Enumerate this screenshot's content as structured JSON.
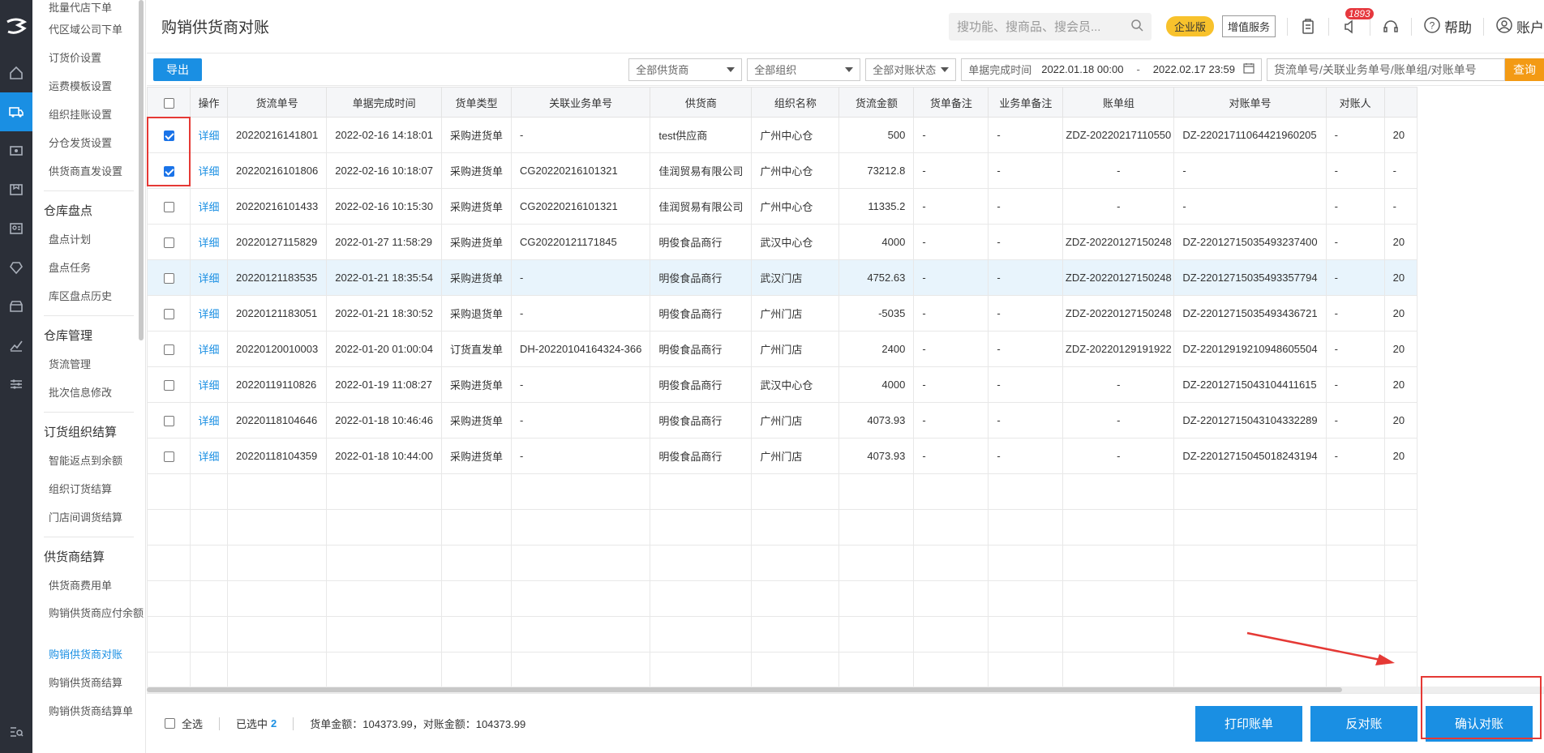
{
  "page": {
    "title": "购销供货商对账"
  },
  "submenu": {
    "items_top": [
      "批量代店下单",
      "代区域公司下单",
      "订货价设置",
      "运费模板设置",
      "组织挂账设置",
      "分仓发货设置",
      "供货商直发设置"
    ],
    "group_inventory": {
      "title": "仓库盘点",
      "items": [
        "盘点计划",
        "盘点任务",
        "库区盘点历史"
      ]
    },
    "group_warehouse": {
      "title": "仓库管理",
      "items": [
        "货流管理",
        "批次信息修改"
      ]
    },
    "group_org_settle": {
      "title": "订货组织结算",
      "items": [
        "智能返点到余额",
        "组织订货结算",
        "门店间调货结算"
      ]
    },
    "group_supplier_settle": {
      "title": "供货商结算",
      "items": [
        "供货商费用单",
        "购销供货商应付余额",
        "购销供货商对账",
        "购销供货商结算",
        "购销供货商结算单"
      ]
    }
  },
  "topbar": {
    "search_placeholder": "搜功能、搜商品、搜会员...",
    "edition_badge": "企业版",
    "value_added": "增值服务",
    "notification_count": "1893",
    "help": "帮助",
    "account": "账户"
  },
  "filters": {
    "export": "导出",
    "supplier": "全部供货商",
    "org": "全部组织",
    "status": "全部对账状态",
    "date_label": "单据完成时间",
    "date_start": "2022.01.18 00:00",
    "date_sep": "-",
    "date_end": "2022.02.17 23:59",
    "keyword_placeholder": "货流单号/关联业务单号/账单组/对账单号",
    "query": "查询"
  },
  "table": {
    "headers": [
      "操作",
      "货流单号",
      "单据完成时间",
      "货单类型",
      "关联业务单号",
      "供货商",
      "组织名称",
      "货流金额",
      "货单备注",
      "业务单备注",
      "账单组",
      "对账单号",
      "对账人",
      ""
    ],
    "detail_label": "详细",
    "rows": [
      {
        "checked": true,
        "flow_no": "20220216141801",
        "time": "2022-02-16 14:18:01",
        "type": "采购进货单",
        "biz_no": "-",
        "supplier": "test供应商",
        "org": "广州中心仓",
        "amount": "500",
        "note": "-",
        "biz_note": "-",
        "bill_group": "ZDZ-20220217110550",
        "recon_no": "DZ-22021711064421960205",
        "reconciler": "-",
        "extra": "20"
      },
      {
        "checked": true,
        "flow_no": "20220216101806",
        "time": "2022-02-16 10:18:07",
        "type": "采购进货单",
        "biz_no": "CG20220216101321",
        "supplier": "佳润贸易有限公司",
        "org": "广州中心仓",
        "amount": "73212.8",
        "note": "-",
        "biz_note": "-",
        "bill_group": "-",
        "recon_no": "-",
        "reconciler": "-",
        "extra": "-"
      },
      {
        "checked": false,
        "flow_no": "20220216101433",
        "time": "2022-02-16 10:15:30",
        "type": "采购进货单",
        "biz_no": "CG20220216101321",
        "supplier": "佳润贸易有限公司",
        "org": "广州中心仓",
        "amount": "11335.2",
        "note": "-",
        "biz_note": "-",
        "bill_group": "-",
        "recon_no": "-",
        "reconciler": "-",
        "extra": "-"
      },
      {
        "checked": false,
        "flow_no": "20220127115829",
        "time": "2022-01-27 11:58:29",
        "type": "采购进货单",
        "biz_no": "CG20220121171845",
        "supplier": "明俊食品商行",
        "org": "武汉中心仓",
        "amount": "4000",
        "note": "-",
        "biz_note": "-",
        "bill_group": "ZDZ-20220127150248",
        "recon_no": "DZ-22012715035493237400",
        "reconciler": "-",
        "extra": "20"
      },
      {
        "checked": false,
        "flow_no": "20220121183535",
        "time": "2022-01-21 18:35:54",
        "type": "采购进货单",
        "biz_no": "-",
        "supplier": "明俊食品商行",
        "org": "武汉门店",
        "amount": "4752.63",
        "note": "-",
        "biz_note": "-",
        "bill_group": "ZDZ-20220127150248",
        "recon_no": "DZ-22012715035493357794",
        "reconciler": "-",
        "extra": "20"
      },
      {
        "checked": false,
        "flow_no": "20220121183051",
        "time": "2022-01-21 18:30:52",
        "type": "采购退货单",
        "biz_no": "-",
        "supplier": "明俊食品商行",
        "org": "广州门店",
        "amount": "-5035",
        "note": "-",
        "biz_note": "-",
        "bill_group": "ZDZ-20220127150248",
        "recon_no": "DZ-22012715035493436721",
        "reconciler": "-",
        "extra": "20"
      },
      {
        "checked": false,
        "flow_no": "20220120010003",
        "time": "2022-01-20 01:00:04",
        "type": "订货直发单",
        "biz_no": "DH-20220104164324-366",
        "supplier": "明俊食品商行",
        "org": "广州门店",
        "amount": "2400",
        "note": "-",
        "biz_note": "-",
        "bill_group": "ZDZ-20220129191922",
        "recon_no": "DZ-22012919210948605504",
        "reconciler": "-",
        "extra": "20"
      },
      {
        "checked": false,
        "flow_no": "20220119110826",
        "time": "2022-01-19 11:08:27",
        "type": "采购进货单",
        "biz_no": "-",
        "supplier": "明俊食品商行",
        "org": "武汉中心仓",
        "amount": "4000",
        "note": "-",
        "biz_note": "-",
        "bill_group": "-",
        "recon_no": "DZ-22012715043104411615",
        "reconciler": "-",
        "extra": "20"
      },
      {
        "checked": false,
        "flow_no": "20220118104646",
        "time": "2022-01-18 10:46:46",
        "type": "采购进货单",
        "biz_no": "-",
        "supplier": "明俊食品商行",
        "org": "广州门店",
        "amount": "4073.93",
        "note": "-",
        "biz_note": "-",
        "bill_group": "-",
        "recon_no": "DZ-22012715043104332289",
        "reconciler": "-",
        "extra": "20"
      },
      {
        "checked": false,
        "flow_no": "20220118104359",
        "time": "2022-01-18 10:44:00",
        "type": "采购进货单",
        "biz_no": "-",
        "supplier": "明俊食品商行",
        "org": "广州门店",
        "amount": "4073.93",
        "note": "-",
        "biz_note": "-",
        "bill_group": "-",
        "recon_no": "DZ-22012715045018243194",
        "reconciler": "-",
        "extra": "20"
      }
    ]
  },
  "footer": {
    "select_all": "全选",
    "selected_label": "已选中",
    "selected_count": "2",
    "totals": "货单金额：104373.99，对账金额：104373.99",
    "print": "打印账单",
    "reverse": "反对账",
    "confirm": "确认对账"
  },
  "colors": {
    "primary": "#1a8fe3",
    "annotation": "#e53935",
    "query_button": "#f39a14"
  }
}
